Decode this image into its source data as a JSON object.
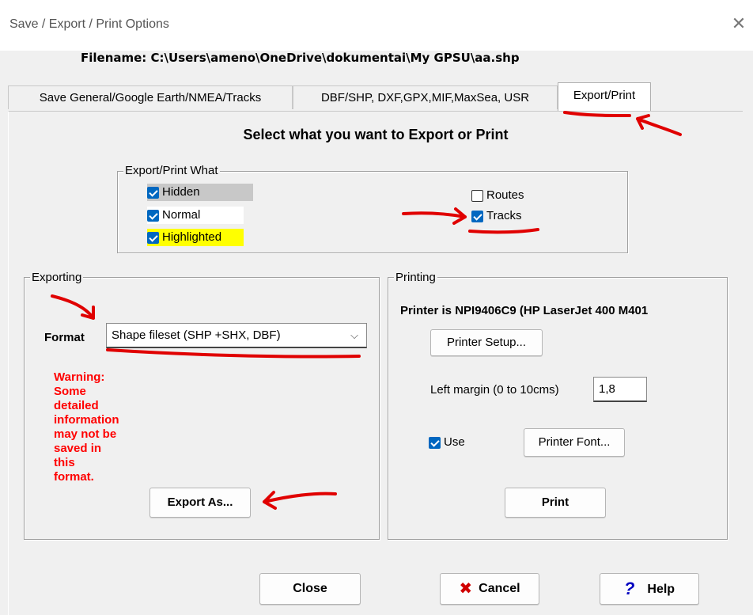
{
  "window": {
    "title": "Save / Export / Print Options",
    "close_glyph": "✕",
    "filename_label": "Filename: C:\\Users\\ameno\\OneDrive\\dokumentai\\My GPSU\\aa.shp"
  },
  "tabs": [
    {
      "label": "Save General/Google Earth/NMEA/Tracks",
      "active": false
    },
    {
      "label": "DBF/SHP, DXF,GPX,MIF,MaxSea, USR",
      "active": false
    },
    {
      "label": "Export/Print",
      "active": true
    }
  ],
  "heading": "Select what you want to Export or Print",
  "export_what": {
    "legend": "Export/Print What",
    "items": [
      {
        "label": "Hidden",
        "checked": true,
        "highlight": "#c8c8c8"
      },
      {
        "label": "Normal",
        "checked": true,
        "highlight": "#ffffff"
      },
      {
        "label": "Highlighted",
        "checked": true,
        "highlight": "#ffff00"
      },
      {
        "label": "Routes",
        "checked": false
      },
      {
        "label": "Tracks",
        "checked": true
      }
    ]
  },
  "exporting": {
    "legend": "Exporting",
    "format_label": "Format",
    "format_value": "Shape fileset (SHP +SHX, DBF)",
    "warning_lines": [
      "Warning:",
      "Some",
      "detailed",
      "information",
      "may not be",
      "saved in",
      "this",
      "format."
    ],
    "export_button": "Export As..."
  },
  "printing": {
    "legend": "Printing",
    "printer_label": "Printer is NPI9406C9 (HP LaserJet 400 M401",
    "printer_setup_button": "Printer Setup...",
    "left_margin_label": "Left margin (0 to 10cms)",
    "left_margin_value": "1,8",
    "use_label": "Use",
    "use_checked": true,
    "printer_font_button": "Printer Font...",
    "print_button": "Print"
  },
  "footer": {
    "close_button": "Close",
    "cancel_button": "Cancel",
    "help_button": "Help"
  },
  "colors": {
    "accent": "#0067c0",
    "warning": "#ff0000",
    "annotation": "#e00000"
  }
}
